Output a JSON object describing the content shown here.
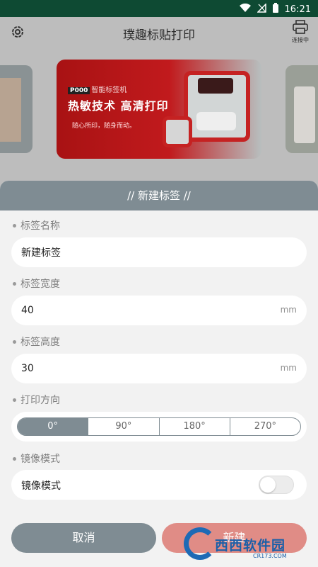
{
  "status_bar": {
    "time": "16:21"
  },
  "header": {
    "title": "璞趣标贴打印",
    "connect_label": "连接中"
  },
  "banner": {
    "brand_code": "P000",
    "brand_text": "智能标签机",
    "headline": "热敏技术 高清打印",
    "tagline": "随心所印，随身而动。"
  },
  "sheet": {
    "title": "// 新建标签 //",
    "name_label": "标签名称",
    "name_value": "新建标签",
    "width_label": "标签宽度",
    "width_value": "40",
    "width_unit": "mm",
    "height_label": "标签高度",
    "height_value": "30",
    "height_unit": "mm",
    "direction_label": "打印方向",
    "directions": [
      "0°",
      "90°",
      "180°",
      "270°"
    ],
    "selected_direction": "0°",
    "mirror_label": "镜像模式",
    "mirror_row_label": "镜像模式",
    "mirror_enabled": false,
    "cancel_label": "取消",
    "create_label": "新建"
  },
  "watermark": {
    "text": "西西软件园",
    "url": "CR173.COM"
  },
  "colors": {
    "accent": "#7f8c93",
    "create_button": "#e08c86",
    "status_bar": "#0e4a33"
  }
}
